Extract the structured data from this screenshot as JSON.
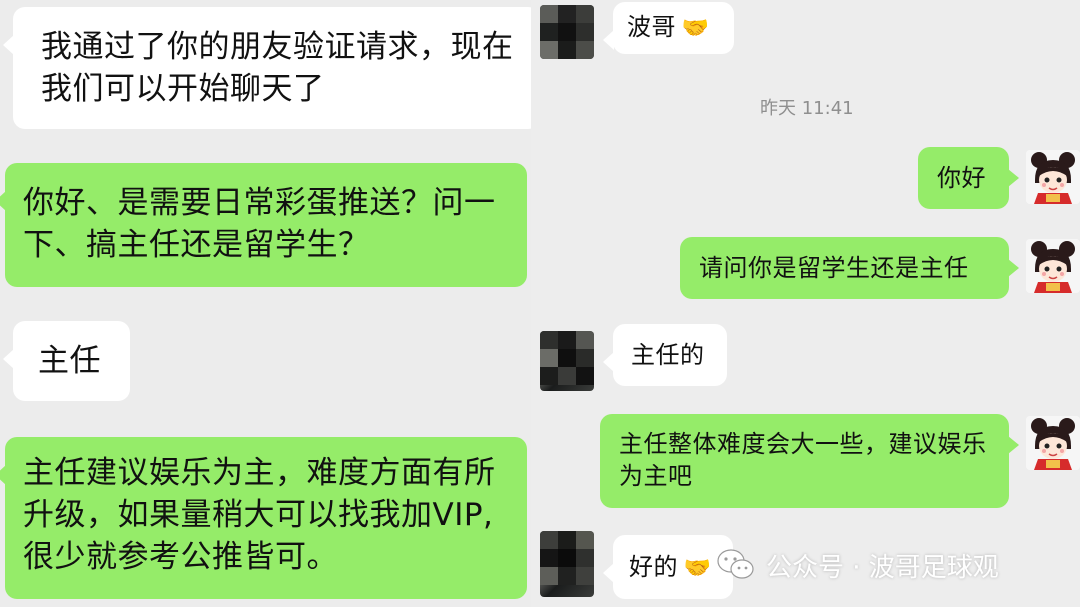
{
  "left_chat": {
    "messages": [
      {
        "type": "white",
        "text": "我通过了你的朋友验证请求，现在我们可以开始聊天了"
      },
      {
        "type": "green",
        "text": "你好、是需要日常彩蛋推送？问一下、搞主任还是留学生？"
      },
      {
        "type": "white",
        "text": "主任"
      },
      {
        "type": "green",
        "text": "主任建议娱乐为主，难度方面有所升级，如果量稍大可以找我加VIP,很少就参考公推皆可。"
      }
    ]
  },
  "right_chat": {
    "timestamp": "昨天 11:41",
    "messages": [
      {
        "type": "white",
        "text": "波哥",
        "emoji": "handshake-emoji"
      },
      {
        "type": "green",
        "text": "你好"
      },
      {
        "type": "green",
        "text": "请问你是留学生还是主任"
      },
      {
        "type": "white",
        "text": "主任的"
      },
      {
        "type": "green",
        "text": "主任整体难度会大一些，建议娱乐为主吧"
      },
      {
        "type": "white",
        "text": "好的",
        "emoji": "handshake-emoji"
      }
    ]
  },
  "watermark": {
    "label": "公众号 · 波哥足球观",
    "icon": "wechat-official-account-icon"
  },
  "colors": {
    "bubble_green": "#95ec69",
    "bubble_white": "#ffffff",
    "background": "#ededed",
    "timestamp": "#8f8f8f"
  }
}
